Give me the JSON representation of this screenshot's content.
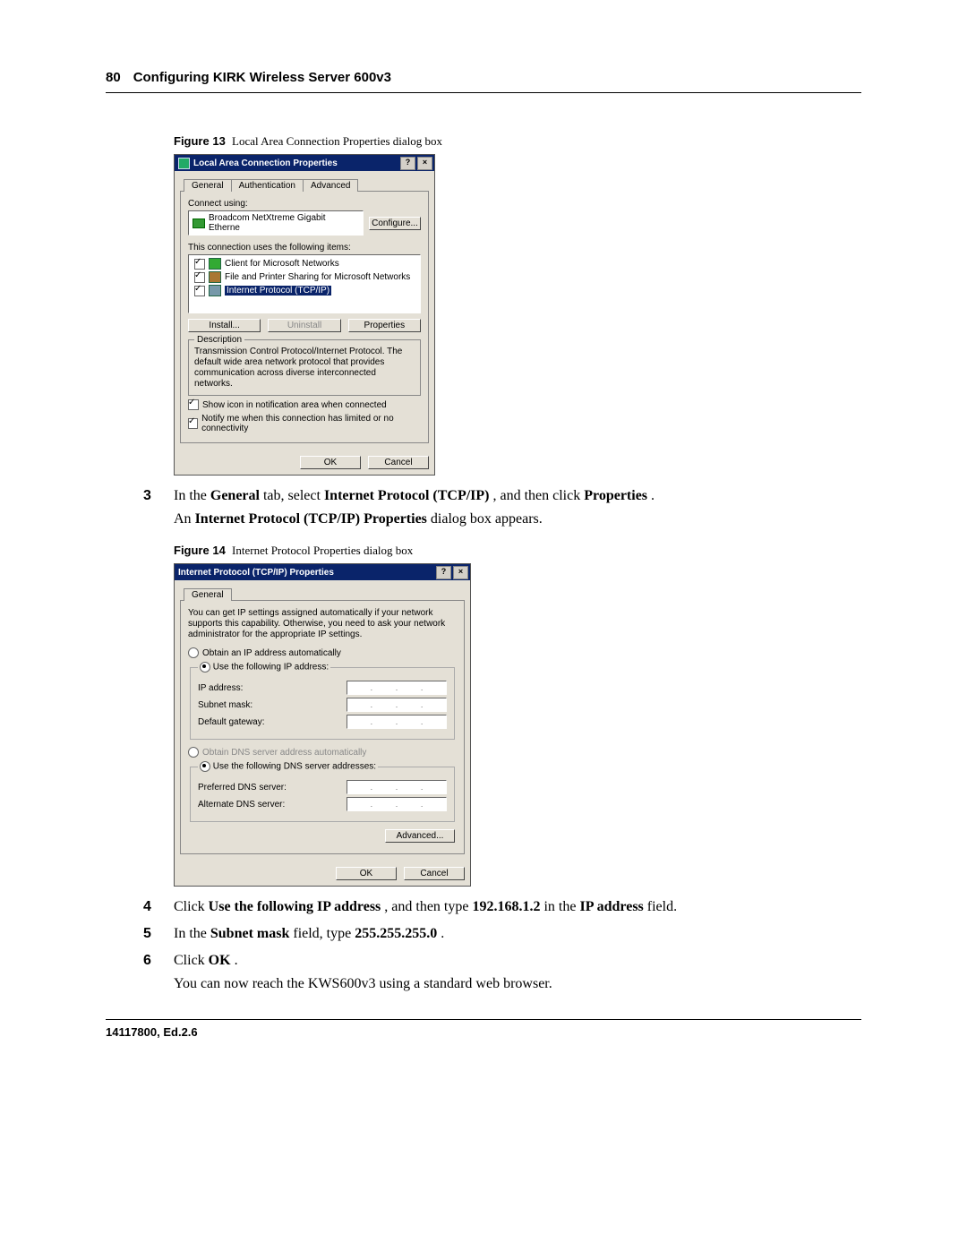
{
  "header": {
    "page": "80",
    "chapter": "Configuring KIRK Wireless Server 600v3"
  },
  "footer": {
    "id": "14117800, Ed.2.6"
  },
  "fig13": {
    "label": "Figure 13",
    "caption": "Local Area Connection Properties dialog box"
  },
  "fig14": {
    "label": "Figure 14",
    "caption": "Internet Protocol Properties dialog box"
  },
  "dlg1": {
    "title": "Local Area Connection Properties",
    "help": "?",
    "close": "×",
    "tabs": [
      "General",
      "Authentication",
      "Advanced"
    ],
    "connectUsingLabel": "Connect using:",
    "adapter": "Broadcom NetXtreme Gigabit Etherne",
    "configureBtn": "Configure...",
    "itemsLabel": "This connection uses the following items:",
    "items": [
      "Client for Microsoft Networks",
      "File and Printer Sharing for Microsoft Networks",
      "Internet Protocol (TCP/IP)"
    ],
    "installBtn": "Install...",
    "uninstallBtn": "Uninstall",
    "propertiesBtn": "Properties",
    "descLegend": "Description",
    "description": "Transmission Control Protocol/Internet Protocol. The default wide area network protocol that provides communication across diverse interconnected networks.",
    "showIcon": "Show icon in notification area when connected",
    "notify": "Notify me when this connection has limited or no connectivity",
    "ok": "OK",
    "cancel": "Cancel"
  },
  "dlg2": {
    "title": "Internet Protocol (TCP/IP) Properties",
    "help": "?",
    "close": "×",
    "tabs": [
      "General"
    ],
    "intro": "You can get IP settings assigned automatically if your network supports this capability. Otherwise, you need to ask your network administrator for the appropriate IP settings.",
    "autoIP": "Obtain an IP address automatically",
    "useIP": "Use the following IP address:",
    "rows": {
      "ip": "IP address:",
      "subnet": "Subnet mask:",
      "gateway": "Default gateway:",
      "pdns": "Preferred DNS server:",
      "adns": "Alternate DNS server:"
    },
    "autoDNS": "Obtain DNS server address automatically",
    "useDNS": "Use the following DNS server addresses:",
    "advanced": "Advanced...",
    "ok": "OK",
    "cancel": "Cancel"
  },
  "steps": {
    "s3": {
      "num": "3",
      "t1": "In the ",
      "b1": "General",
      "t2": " tab, select ",
      "b2": "Internet Protocol (TCP/IP)",
      "t3": ", and then click ",
      "b3": "Properties",
      "t4": "."
    },
    "s3b": {
      "t1": "An ",
      "b1": "Internet Protocol (TCP/IP) Properties",
      "t2": " dialog box appears."
    },
    "s4": {
      "num": "4",
      "t1": "Click ",
      "b1": "Use the following IP address",
      "t2": ", and then type ",
      "b2": "192.168.1.2",
      "t3": " in the ",
      "b3": "IP address",
      "t4": " field."
    },
    "s5": {
      "num": "5",
      "t1": "In the ",
      "b1": "Subnet mask",
      "t2": " field, type ",
      "b2": "255.255.255.0",
      "t3": "."
    },
    "s6": {
      "num": "6",
      "t1": "Click ",
      "b1": "OK",
      "t2": "."
    },
    "s6b": "You can now reach the KWS600v3 using a standard web browser."
  }
}
